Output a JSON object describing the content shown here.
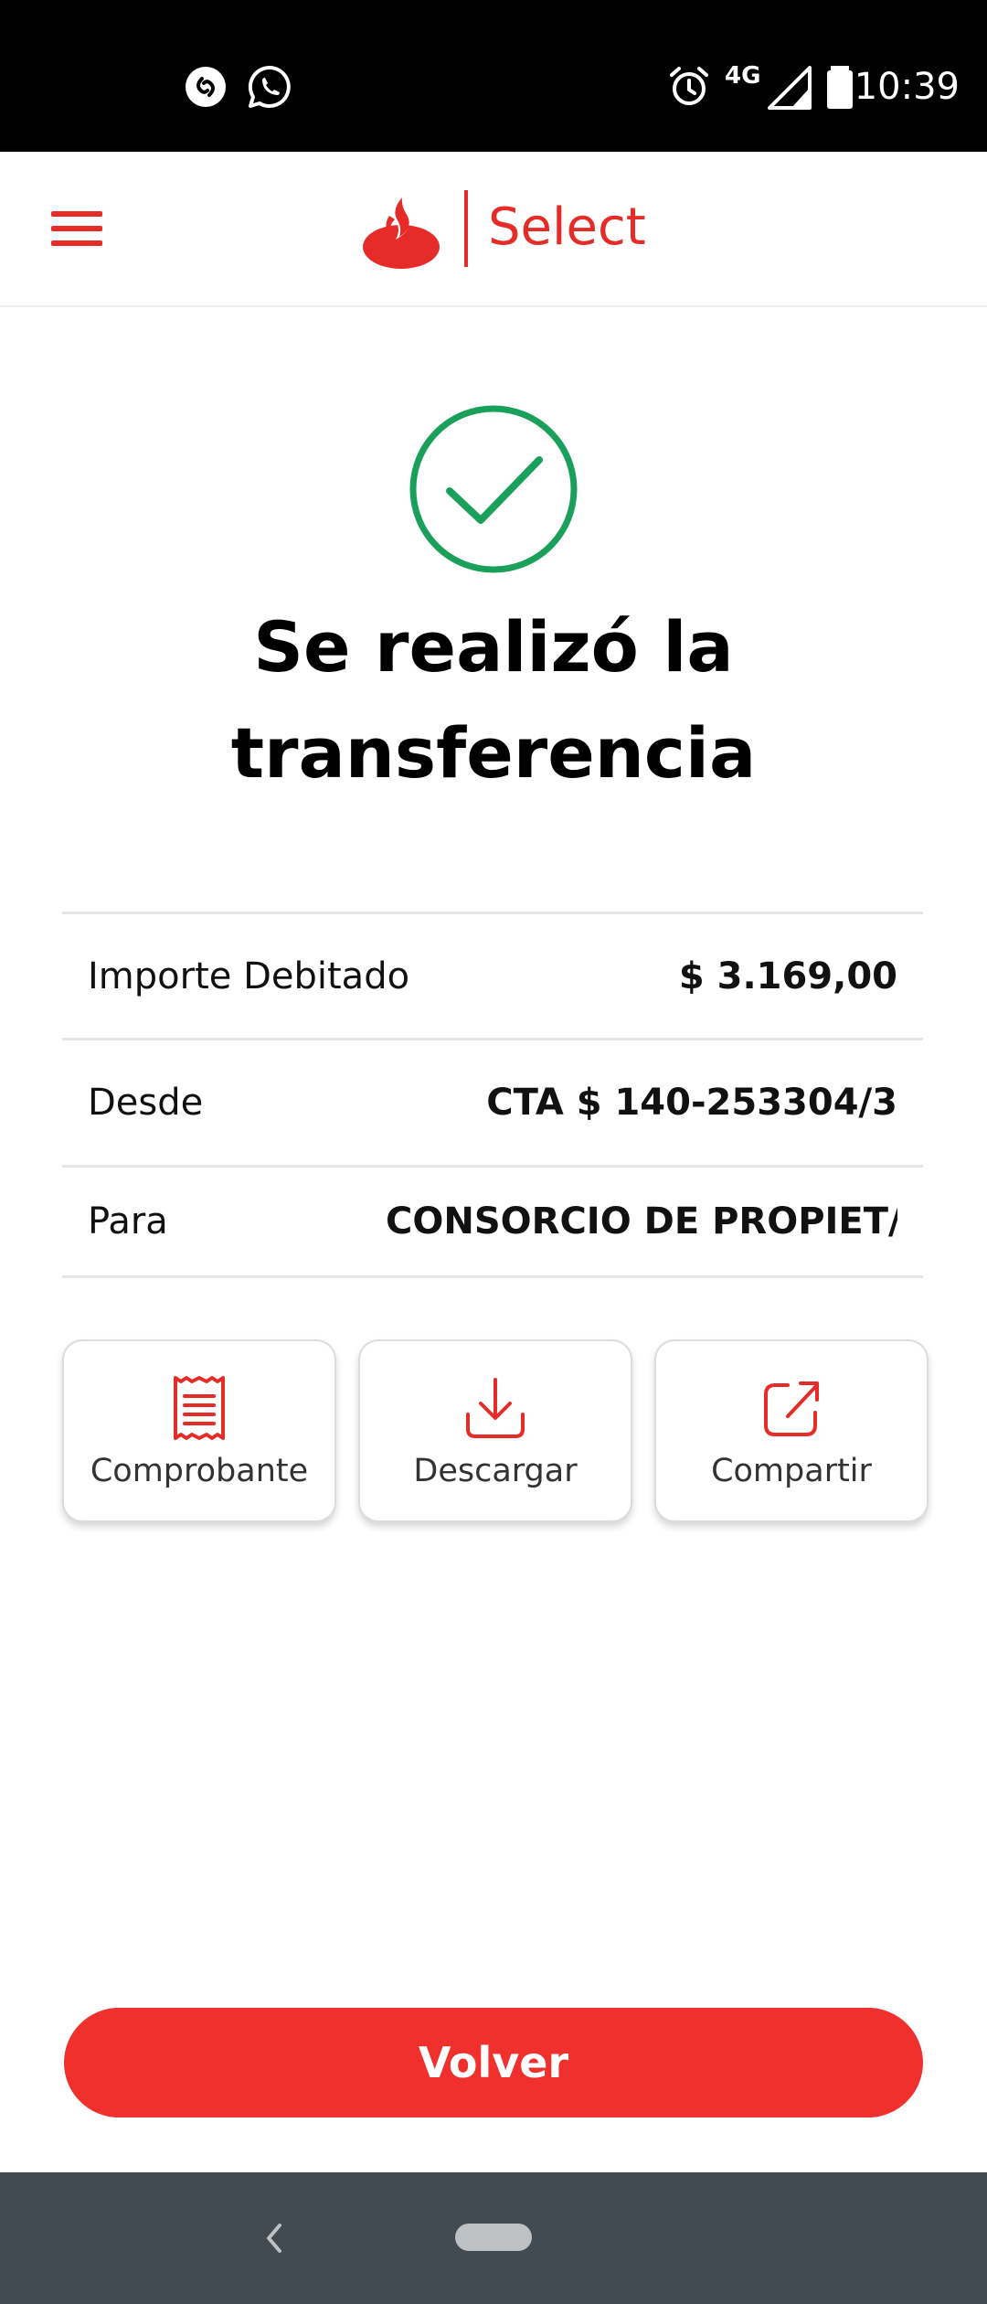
{
  "status_bar": {
    "time": "10:39",
    "network": "4G",
    "icons": [
      "shazam-icon",
      "whatsapp-icon",
      "alarm-icon",
      "signal-icon",
      "battery-icon"
    ]
  },
  "header": {
    "brand_name": "Select",
    "brand_color": "#e52c28"
  },
  "success": {
    "title": "Se realizó la transferencia",
    "icon_color": "#1aa05a"
  },
  "details": [
    {
      "label": "Importe Debitado",
      "value": "$ 3.169,00"
    },
    {
      "label": "Desde",
      "value": "CTA $ 140-253304/3"
    },
    {
      "label": "Para",
      "value": "CONSORCIO DE PROPIET/"
    }
  ],
  "actions": [
    {
      "label": "Comprobante",
      "icon": "receipt-icon"
    },
    {
      "label": "Descargar",
      "icon": "download-icon"
    },
    {
      "label": "Compartir",
      "icon": "share-icon"
    }
  ],
  "primary_button": {
    "label": "Volver",
    "color": "#ef302c"
  }
}
